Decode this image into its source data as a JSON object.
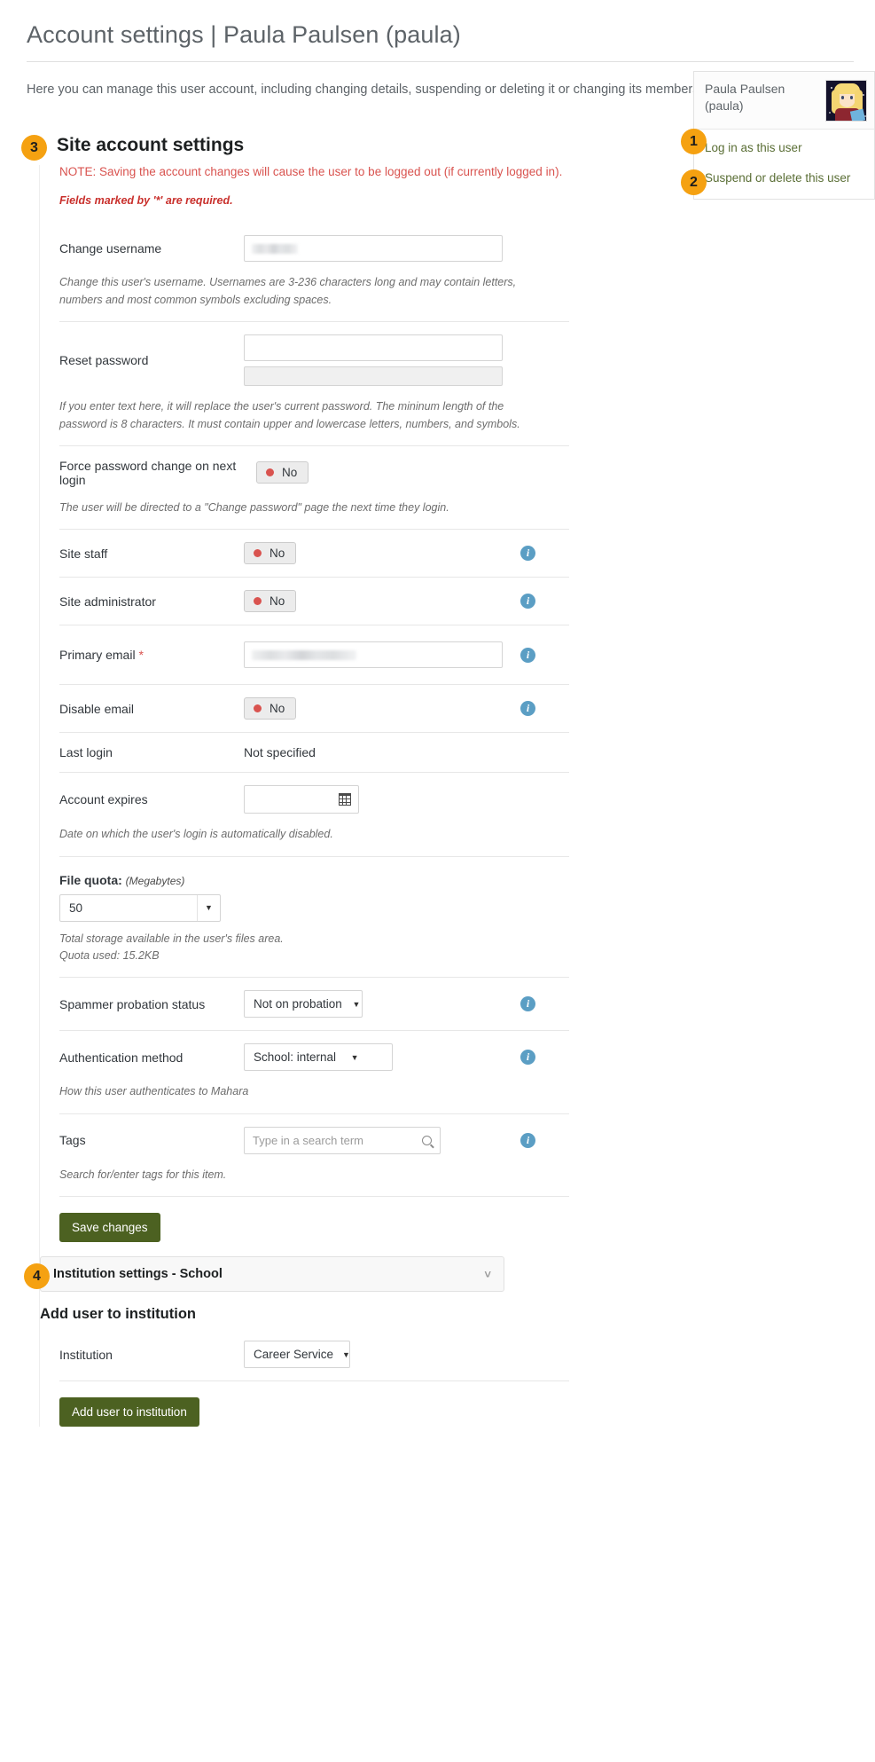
{
  "header": {
    "title": "Account settings | Paula Paulsen (paula)",
    "intro": "Here you can manage this user account, including changing details, suspending or deleting it or changing its membership in institutions."
  },
  "side_card": {
    "user_name_line1": "Paula Paulsen",
    "user_name_line2": "(paula)",
    "avatar_alt": "user-avatar",
    "links": [
      {
        "badge": "1",
        "label": "Log in as this user"
      },
      {
        "badge": "2",
        "label": "Suspend or delete this user"
      }
    ]
  },
  "section": {
    "badge": "3",
    "title": "Site account settings",
    "note": "NOTE: Saving the account changes will cause the user to be logged out (if currently logged in).",
    "required_note": "Fields marked by '*' are required."
  },
  "fields": {
    "change_username": {
      "label": "Change username",
      "value": "",
      "help": "Change this user's username. Usernames are 3-236 characters long and may contain letters, numbers and most common symbols excluding spaces."
    },
    "reset_password": {
      "label": "Reset password",
      "value": "",
      "help": "If you enter text here, it will replace the user's current password. The mininum length of the password is 8 characters. It must contain upper and lowercase letters, numbers, and symbols."
    },
    "force_password_change": {
      "label": "Force password change on next login",
      "toggle": "No",
      "help": "The user will be directed to a \"Change password\" page the next time they login."
    },
    "site_staff": {
      "label": "Site staff",
      "toggle": "No",
      "info": "i"
    },
    "site_administrator": {
      "label": "Site administrator",
      "toggle": "No",
      "info": "i"
    },
    "primary_email": {
      "label": "Primary email",
      "required": "*",
      "value": "",
      "info": "i"
    },
    "disable_email": {
      "label": "Disable email",
      "toggle": "No",
      "info": "i"
    },
    "last_login": {
      "label": "Last login",
      "value": "Not specified"
    },
    "account_expires": {
      "label": "Account expires",
      "value": "",
      "icon": "calendar-icon",
      "help": "Date on which the user's login is automatically disabled."
    },
    "file_quota": {
      "label": "File quota:",
      "unit": "(Megabytes)",
      "value": "50",
      "help_line1": "Total storage available in the user's files area.",
      "help_line2": "Quota used: 15.2KB"
    },
    "spammer_probation": {
      "label": "Spammer probation status",
      "value": "Not on probation",
      "info": "i"
    },
    "authentication_method": {
      "label": "Authentication method",
      "value": "School: internal",
      "info": "i",
      "help": "How this user authenticates to Mahara"
    },
    "tags": {
      "label": "Tags",
      "placeholder": "Type in a search term",
      "value": "",
      "info": "i",
      "help": "Search for/enter tags for this item."
    }
  },
  "buttons": {
    "save_changes": "Save changes",
    "add_user_to_institution": "Add user to institution"
  },
  "institution_panel": {
    "badge": "4",
    "title": "Institution settings - School",
    "chevron": "chevron-down-icon",
    "subtitle": "Add user to institution",
    "institution_label": "Institution",
    "institution_value": "Career Service"
  },
  "colors": {
    "accent_orange": "#f5a111",
    "danger_red": "#d9534f",
    "green_button": "#4c6121",
    "info_blue": "#5b9ec4",
    "link_green": "#5a6e35"
  }
}
